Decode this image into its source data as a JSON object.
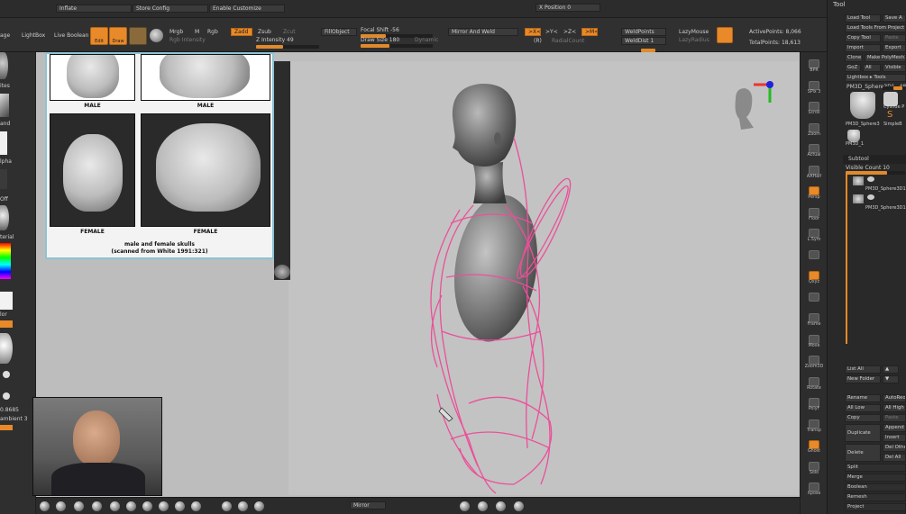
{
  "app": {
    "tool_title": "Tool"
  },
  "topbar1": {
    "inflate": "Inflate",
    "store_config": "Store Config",
    "enable_customize": "Enable Customize",
    "x_position": "X Position 0"
  },
  "topbar2": {
    "storage": "age",
    "lightbox": "LightBox",
    "live_boolean": "Live Boolean",
    "edit": "Edit",
    "draw": "Draw",
    "move": "Move",
    "scale": "Scale",
    "rotate": "Rotate",
    "mrgb": "Mrgb",
    "m": "M",
    "rgb": "Rgb",
    "rgb_intensity": "Rgb Intensity",
    "zadd": "Zadd",
    "zsub": "Zsub",
    "zcut": "Zcut",
    "z_intensity": "Z Intensity 49",
    "fill_object": "FillObject",
    "focal_shift": "Focal Shift -56",
    "draw_size": "Draw Size 180",
    "dynamic": "Dynamic",
    "mirror_weld": "Mirror And Weld",
    "sym_x": ">X<",
    "sym_y": ">Y<",
    "sym_z": ">Z<",
    "sym_m": ">M<",
    "r_btn": "(R)",
    "radial_count": "RadialCount",
    "weld_points": "WeldPoints",
    "weld_dist": "WeldDist 1",
    "lazy_mouse": "LazyMouse",
    "lazy_radius": "LazyRadius",
    "active_points": "ActivePoints: 8,066",
    "total_points": "TotalPoints: 18,613"
  },
  "leftpanel": {
    "labels": [
      "ites",
      "and",
      "lpha",
      "Off",
      "terial",
      "lor",
      "0.8685",
      "ambient 3"
    ]
  },
  "reference": {
    "top_left_label": "MALE",
    "top_right_label": "MALE",
    "bottom_left_label": "FEMALE",
    "bottom_right_label": "FEMALE",
    "caption_line1": "male and female skulls",
    "caption_line2": "(scanned from White 1991:321)"
  },
  "shelf": [
    {
      "label": "BPR",
      "active": false
    },
    {
      "label": "SPix 3",
      "active": false
    },
    {
      "label": "Scroll",
      "active": false
    },
    {
      "label": "Zoom",
      "active": false
    },
    {
      "label": "Actual",
      "active": false
    },
    {
      "label": "AAHalf",
      "active": false
    },
    {
      "label": "Persp",
      "active": true
    },
    {
      "label": "Floor",
      "active": false
    },
    {
      "label": "L.Sym",
      "active": false
    },
    {
      "label": "",
      "active": false
    },
    {
      "label": "Qxyz",
      "active": true
    },
    {
      "label": "",
      "active": false
    },
    {
      "label": "Frame",
      "active": false
    },
    {
      "label": "Move",
      "active": false
    },
    {
      "label": "Zoom3D",
      "active": false
    },
    {
      "label": "Rotate",
      "active": false
    },
    {
      "label": "PolyF",
      "active": false
    },
    {
      "label": "Transp",
      "active": false
    },
    {
      "label": "Ghost",
      "active": true
    },
    {
      "label": "Solo",
      "active": false
    },
    {
      "label": "Xpose",
      "active": false
    }
  ],
  "toolpanel": {
    "load_tool": "Load Tool",
    "save_as": "Save A",
    "load_tools_project": "Load Tools From Project",
    "copy_tool": "Copy Tool",
    "paste": "Paste",
    "import": "Import",
    "export": "Export",
    "clone": "Clone",
    "make_polymesh": "Make PolyMesh3",
    "goz": "GoZ",
    "all": "All",
    "visible": "Visible",
    "lightbox_tools": "Lightbox ▸ Tools",
    "current_tool": "PM3D_Sphere3D1_ 48",
    "thumb1": "PM3D_Sphere3",
    "thumb2": "Cylinde P",
    "thumb3": "SimpleB",
    "thumb4": "PM3D_1",
    "subtool": "Subtool",
    "visible_count": "Visible Count 10",
    "sub1": "PM3D_Sphere3D1",
    "sub2": "PM3D_Sphere3D1",
    "list_all": "List All",
    "new_folder": "New Folder",
    "rename": "Rename",
    "auto_reorder": "AutoReo",
    "all_low": "All Low",
    "all_high": "All High",
    "copy": "Copy",
    "paste2": "Paste",
    "duplicate": "Duplicate",
    "append": "Append",
    "insert": "Insert",
    "delete": "Delete",
    "del_other": "Del Othe",
    "del_all": "Del All",
    "split": "Split",
    "merge": "Merge",
    "boolean": "Boolean",
    "remesh": "Remesh",
    "project": "Project",
    "extract": "Extract"
  },
  "bottombar": {
    "mirror": "Mirror"
  },
  "colors": {
    "accent": "#e8892a",
    "stroke": "#ec4f99",
    "viewport": "#c3c3c3"
  }
}
